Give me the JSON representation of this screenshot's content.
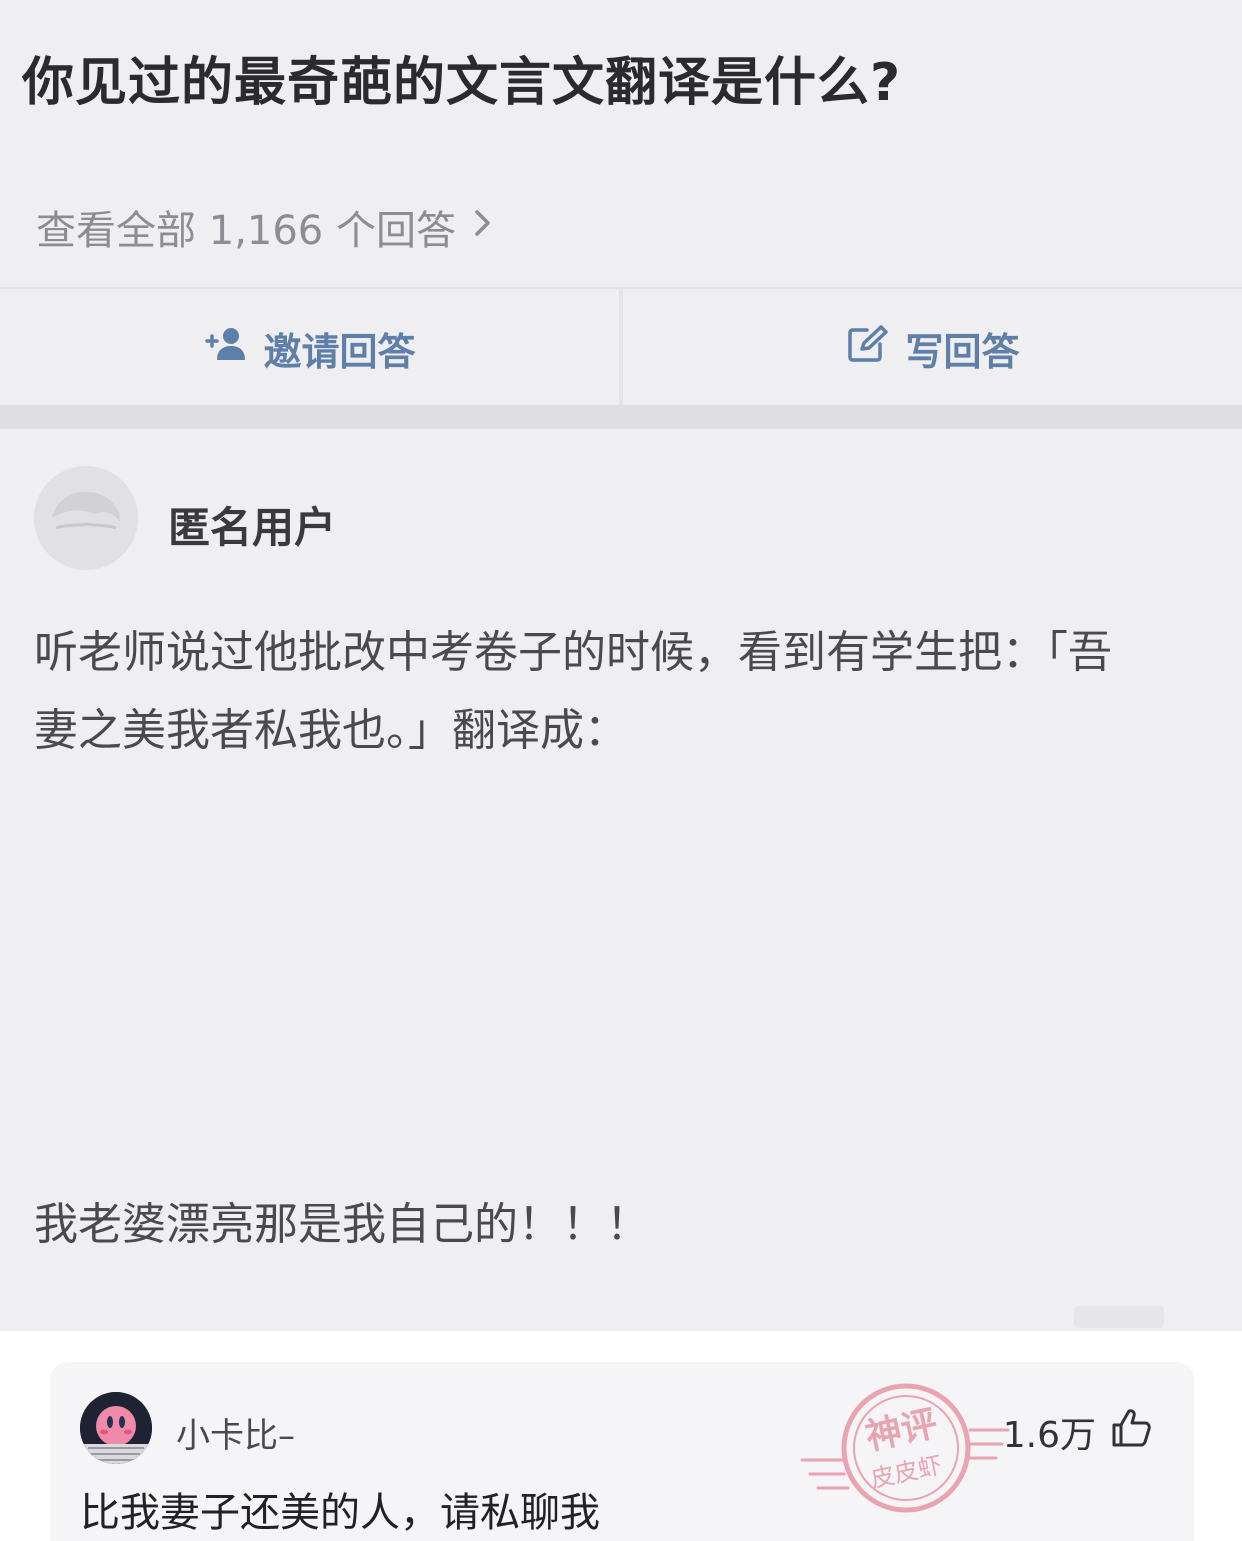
{
  "question": {
    "title": "你见过的最奇葩的文言文翻译是什么?",
    "view_all": "查看全部 1,166 个回答"
  },
  "actions": {
    "invite_label": "邀请回答",
    "write_label": "写回答"
  },
  "answer": {
    "author": "匿名用户",
    "paragraph1": "听老师说过他批改中考卷子的时候，看到有学生把：「吾妻之美我者私我也。」翻译成：",
    "paragraph2": "我老婆漂亮那是我自己的！！！"
  },
  "comment": {
    "username": "小卡比–",
    "text": "比我妻子还美的人，请私聊我",
    "likes": "1.6万"
  },
  "watermark": {
    "line1": "神评",
    "line2": "皮皮虾"
  },
  "colors": {
    "screenshot_bg": "#efeef1",
    "action_blue": "#5e7fa8",
    "stamp_red": "#e0637a"
  },
  "icons": [
    "chevron-right-icon",
    "add-person-icon",
    "edit-icon",
    "thumbs-up-icon"
  ]
}
